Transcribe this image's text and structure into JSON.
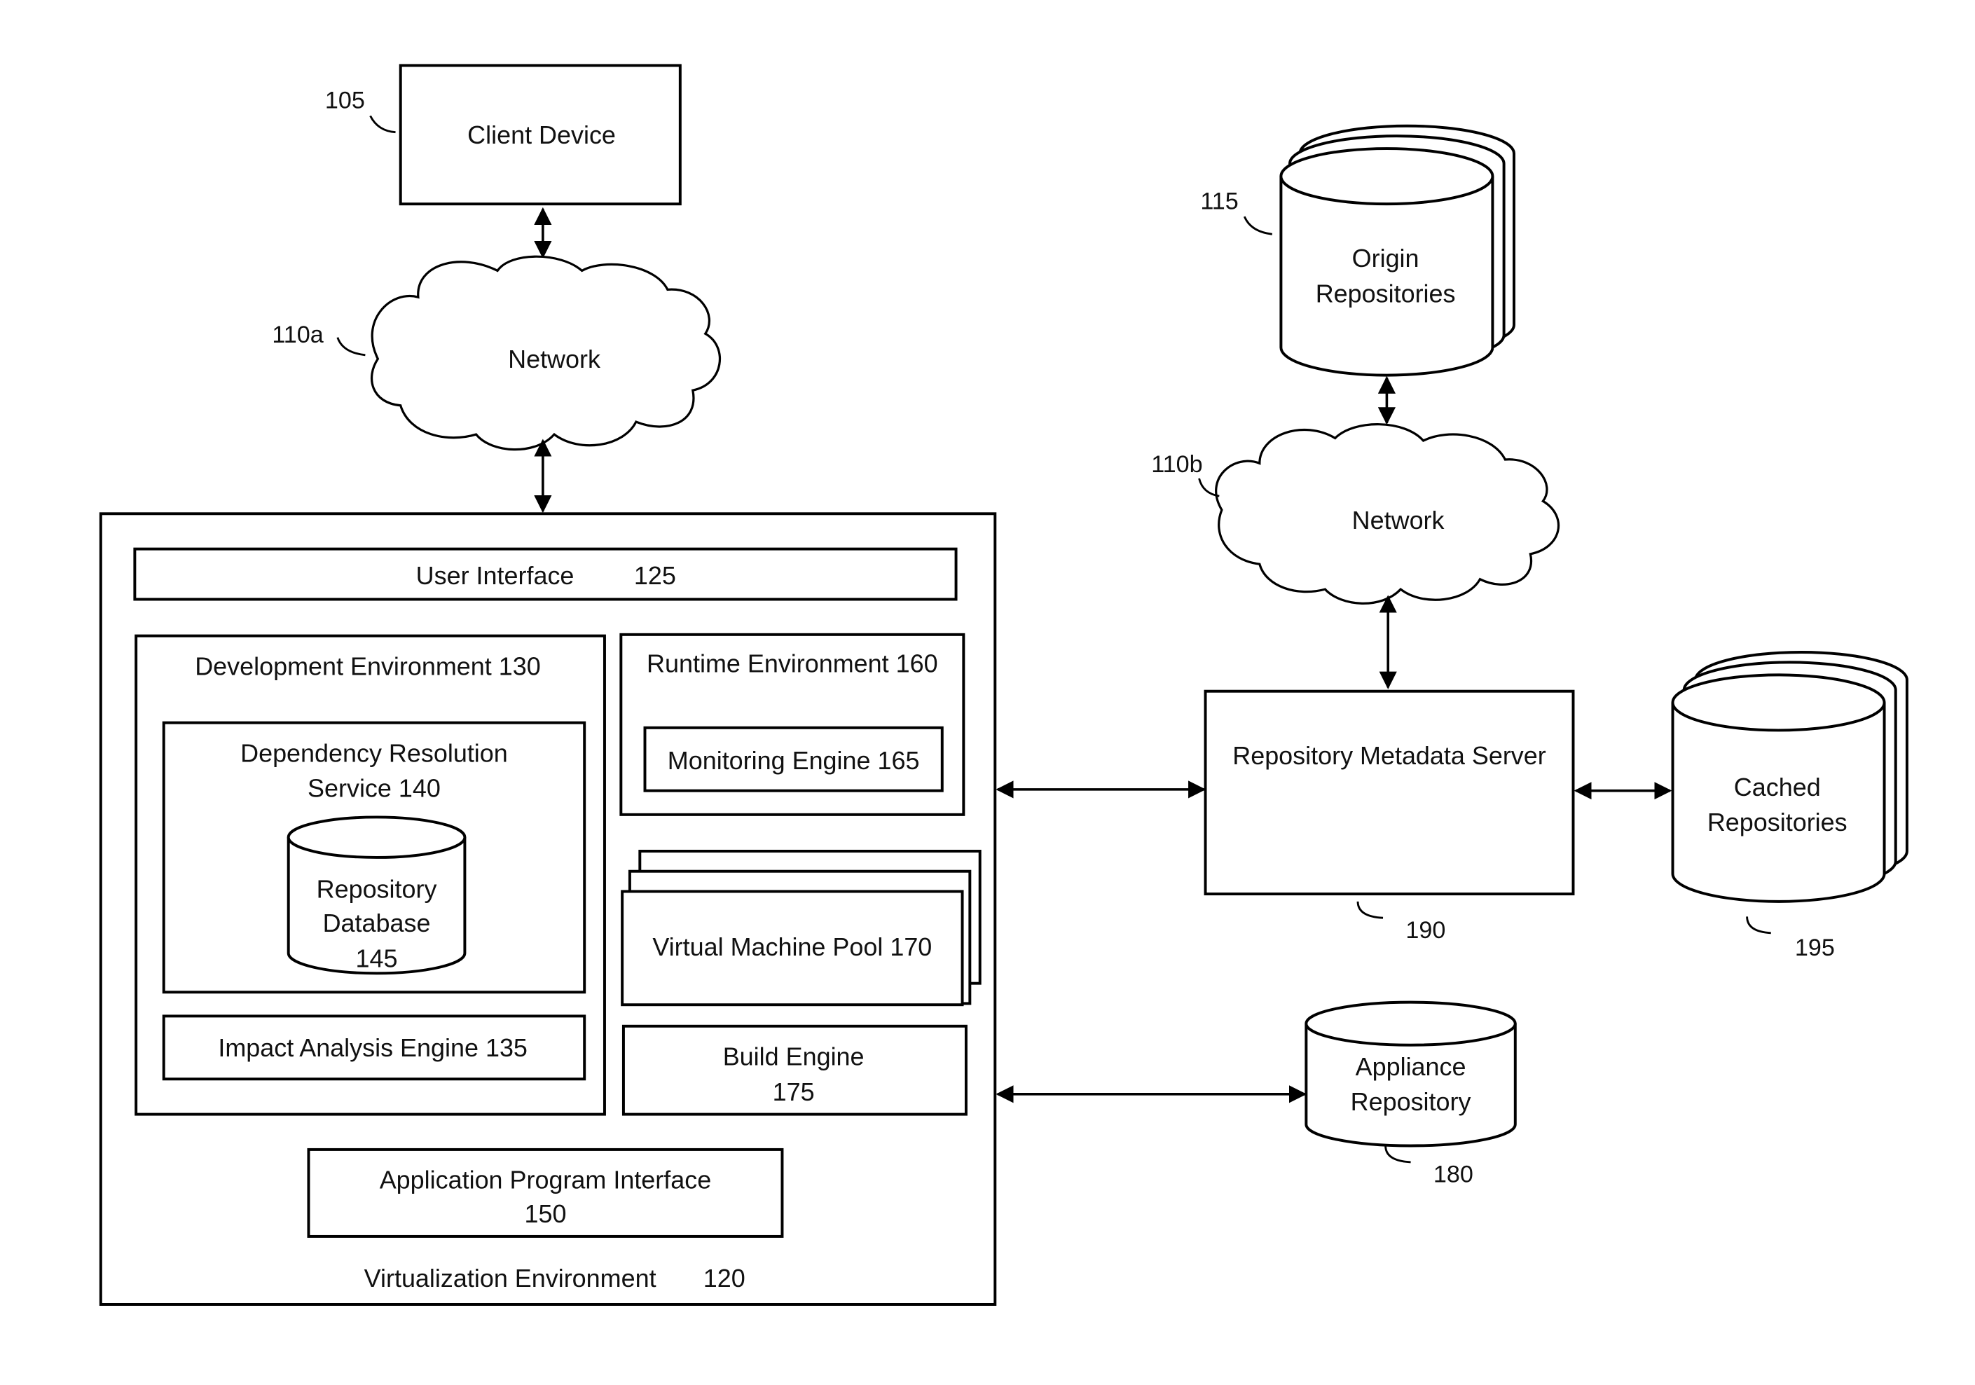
{
  "diagram": {
    "client_device": {
      "label": "Client Device",
      "ref": "105"
    },
    "network_a": {
      "label": "Network",
      "ref": "110a"
    },
    "network_b": {
      "label": "Network",
      "ref": "110b"
    },
    "origin_repositories": {
      "line1": "Origin",
      "line2": "Repositories",
      "ref": "115"
    },
    "virtualization_environment": {
      "label": "Virtualization Environment",
      "ref": "120"
    },
    "user_interface": {
      "label": "User Interface",
      "ref": "125"
    },
    "development_environment": {
      "label": "Development Environment 130"
    },
    "dependency_resolution_service": {
      "line1": "Dependency Resolution",
      "line2": "Service 140"
    },
    "repository_database": {
      "line1": "Repository",
      "line2": "Database",
      "line3": "145"
    },
    "impact_analysis_engine": {
      "label": "Impact Analysis Engine 135"
    },
    "runtime_environment": {
      "label": "Runtime Environment 160"
    },
    "monitoring_engine": {
      "label": "Monitoring Engine 165"
    },
    "virtual_machine_pool": {
      "label": "Virtual Machine Pool 170"
    },
    "build_engine": {
      "line1": "Build Engine",
      "line2": "175"
    },
    "application_program_interface": {
      "line1": "Application Program Interface",
      "line2": "150"
    },
    "repository_metadata_server": {
      "label": "Repository Metadata Server",
      "ref": "190"
    },
    "cached_repositories": {
      "line1": "Cached",
      "line2": "Repositories",
      "ref": "195"
    },
    "appliance_repository": {
      "line1": "Appliance",
      "line2": "Repository",
      "ref": "180"
    }
  }
}
